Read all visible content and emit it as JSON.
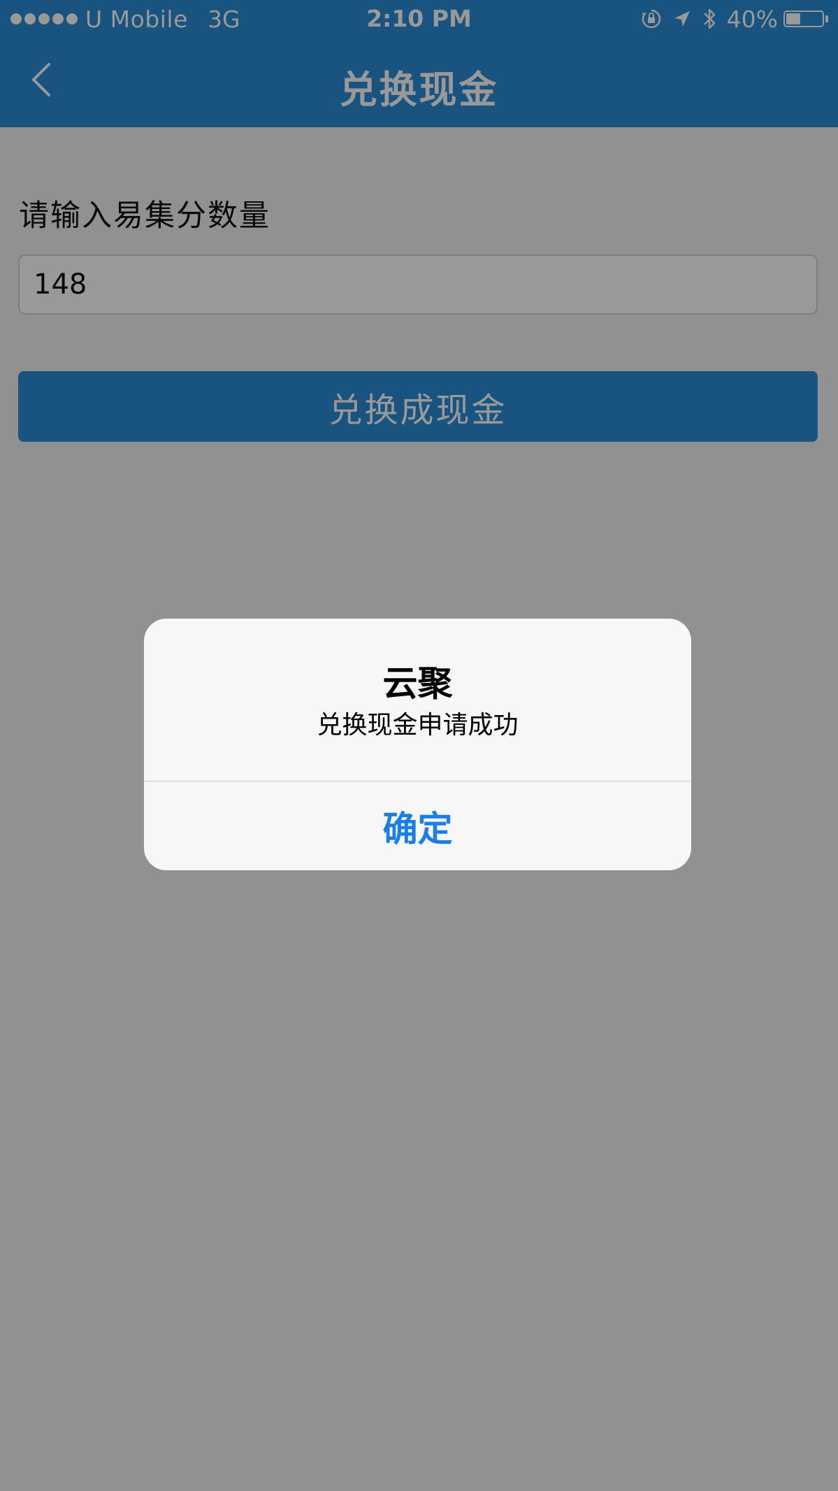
{
  "status_bar": {
    "carrier": "U Mobile",
    "network": "3G",
    "time": "2:10 PM",
    "battery_percent": "40%",
    "battery_level": 0.4,
    "icons": [
      "signal-dots-icon",
      "orientation-lock-icon",
      "location-arrow-icon",
      "bluetooth-icon",
      "battery-icon"
    ]
  },
  "nav": {
    "title": "兑换现金",
    "back_icon": "chevron-left-icon"
  },
  "form": {
    "label": "请输入易集分数量",
    "points_value": "148",
    "submit_label": "兑换成现金"
  },
  "alert": {
    "title": "云聚",
    "message": "兑换现金申请成功",
    "ok_label": "确定"
  },
  "colors": {
    "primary": "#2a8ad4",
    "alert_action": "#1a7ee6",
    "overlay": "rgba(0,0,0,0.4)"
  }
}
